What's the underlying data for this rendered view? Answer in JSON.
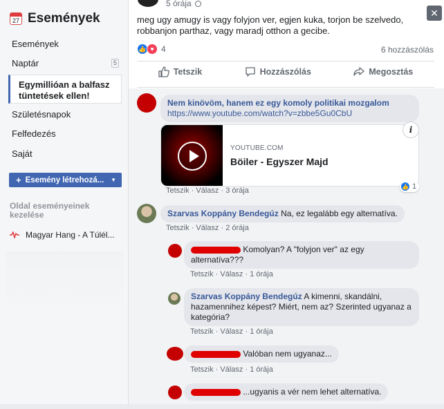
{
  "sidebar": {
    "title": "Események",
    "calendar_day": "27",
    "items": [
      {
        "label": "Események"
      },
      {
        "label": "Naptár",
        "badge": "5"
      },
      {
        "label": "Egymillióan a balfasz tüntetések ellen!",
        "lines": [
          "Egymillióan a balfasz",
          "tüntetések ellen!"
        ]
      },
      {
        "label": "Születésnapok"
      },
      {
        "label": "Felfedezés"
      },
      {
        "label": "Saját"
      }
    ],
    "create_button": "Esemény létrehozá...",
    "section_title": "Oldal eseményeinek kezelése",
    "page_item": "Magyar Hang - A Túlél..."
  },
  "post": {
    "time": "5 órája",
    "text": "meg ugy amugy is vagy folyjon ver, egjen kuka, torjon be szelvedo, robbanjon parthaz, vagy maradj otthon a gecibe.",
    "reaction_count": "4",
    "comment_count": "6 hozzászólás",
    "actions": {
      "like": "Tetszik",
      "comment": "Hozzászólás",
      "share": "Megosztás"
    }
  },
  "comments": [
    {
      "author": "Nem kinövöm, hanem ez egy komoly politikai mozgalom",
      "link": "https://www.youtube.com/watch?v=zbbe5Gu0CbU",
      "card": {
        "domain": "YOUTUBE.COM",
        "title": "Böiler - Egyszer Majd"
      },
      "likes": "1",
      "meta": {
        "like": "Tetszik",
        "reply": "Válasz",
        "time": "3 órája"
      }
    },
    {
      "author": "Szarvas Koppány Bendegúz",
      "text": "Na, ez legalább egy alternatíva.",
      "meta": {
        "like": "Tetszik",
        "reply": "Válasz",
        "time": "2 órája"
      }
    }
  ],
  "replies": [
    {
      "text": "Komolyan? A \"folyjon ver\" az egy alternatíva???",
      "lines": [
        "Komolyan? A \"folyjon ver\" az egy",
        "alternatíva???"
      ],
      "meta": {
        "like": "Tetszik",
        "reply": "Válasz",
        "time": "1 órája"
      }
    },
    {
      "author": "Szarvas Koppány Bendegúz",
      "text": "A kimenni, skandálni, hazamennihez képest? Miért, nem az? Szerinted ugyanaz a kategória?",
      "meta": {
        "like": "Tetszik",
        "reply": "Válasz",
        "time": "1 órája"
      }
    },
    {
      "text": "Valóban nem ugyanaz...",
      "meta": {
        "like": "Tetszik",
        "reply": "Válasz",
        "time": "1 órája"
      }
    },
    {
      "text": "...ugyanis a vér nem lehet alternatíva."
    }
  ],
  "colors": {
    "brand": "#4267b2",
    "link": "#385898",
    "redaction": "#e00000"
  }
}
